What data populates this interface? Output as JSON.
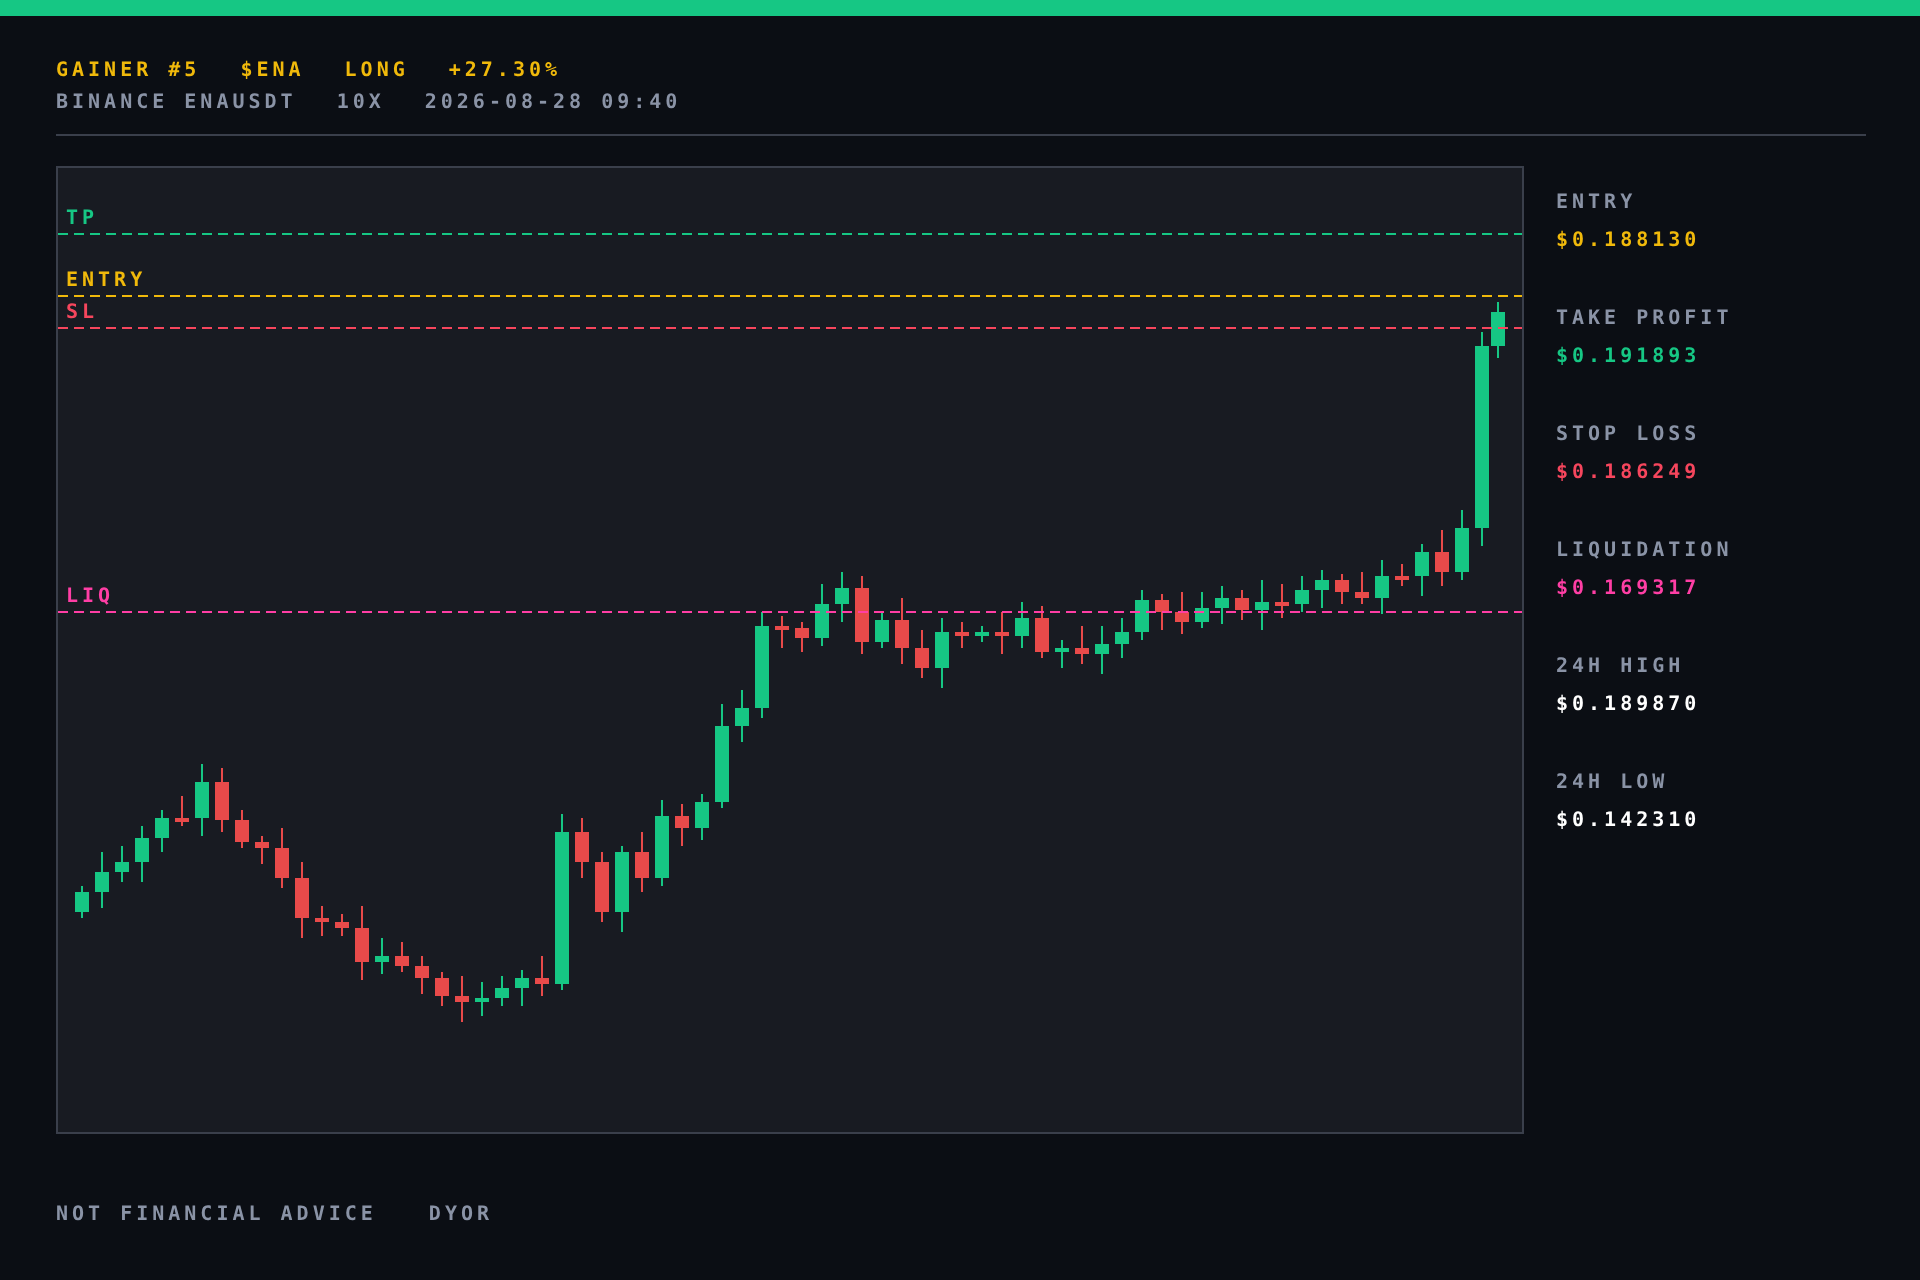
{
  "header": {
    "title": [
      "GAINER #5",
      "$ENA",
      "LONG",
      "+27.30%"
    ],
    "subtitle": [
      "BINANCE ENAUSDT",
      "10X",
      "2026-08-28 09:40"
    ]
  },
  "chart": {
    "price_lines": [
      {
        "label": "TP",
        "kind": "tp",
        "color": "#16c784"
      },
      {
        "label": "ENTRY",
        "kind": "entry",
        "color": "#f0b90b"
      },
      {
        "label": "SL",
        "kind": "sl",
        "color": "#f6465d"
      },
      {
        "label": "LIQ",
        "kind": "liq",
        "color": "#ff3ea5"
      }
    ]
  },
  "stats": [
    {
      "label": "ENTRY",
      "value": "$0.188130",
      "color": "#f0b90b"
    },
    {
      "label": "TAKE PROFIT",
      "value": "$0.191893",
      "color": "#16c784"
    },
    {
      "label": "STOP LOSS",
      "value": "$0.186249",
      "color": "#f6465d"
    },
    {
      "label": "LIQUIDATION",
      "value": "$0.169317",
      "color": "#ff3ea5"
    },
    {
      "label": "24H HIGH",
      "value": "$0.189870",
      "color": "#ffffff"
    },
    {
      "label": "24H LOW",
      "value": "$0.142310",
      "color": "#ffffff"
    }
  ],
  "footer": [
    "NOT FINANCIAL ADVICE",
    "DYOR"
  ]
}
